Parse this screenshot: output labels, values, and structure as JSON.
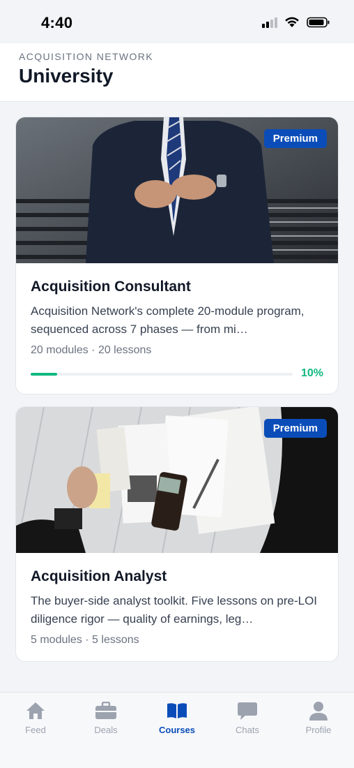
{
  "status_bar": {
    "time": "4:40"
  },
  "header": {
    "eyebrow": "ACQUISITION NETWORK",
    "title": "University"
  },
  "courses": [
    {
      "badge": "Premium",
      "title": "Acquisition Consultant",
      "description": "Acquisition Network's complete 20-module program, sequenced across 7 phases — from mi…",
      "meta": "20 modules · 20 lessons",
      "progress": 0.1,
      "progress_label": "10%"
    },
    {
      "badge": "Premium",
      "title": "Acquisition Analyst",
      "description": "The buyer-side analyst toolkit. Five lessons on pre-LOI diligence rigor — quality of earnings, leg…",
      "meta": "5 modules · 5 lessons"
    }
  ],
  "tabs": [
    {
      "label": "Feed",
      "icon": "home-icon"
    },
    {
      "label": "Deals",
      "icon": "briefcase-icon"
    },
    {
      "label": "Courses",
      "icon": "book-icon",
      "active": true
    },
    {
      "label": "Chats",
      "icon": "chat-icon"
    },
    {
      "label": "Profile",
      "icon": "person-icon"
    }
  ],
  "colors": {
    "accent": "#0b4db8",
    "progress": "#10b981"
  }
}
